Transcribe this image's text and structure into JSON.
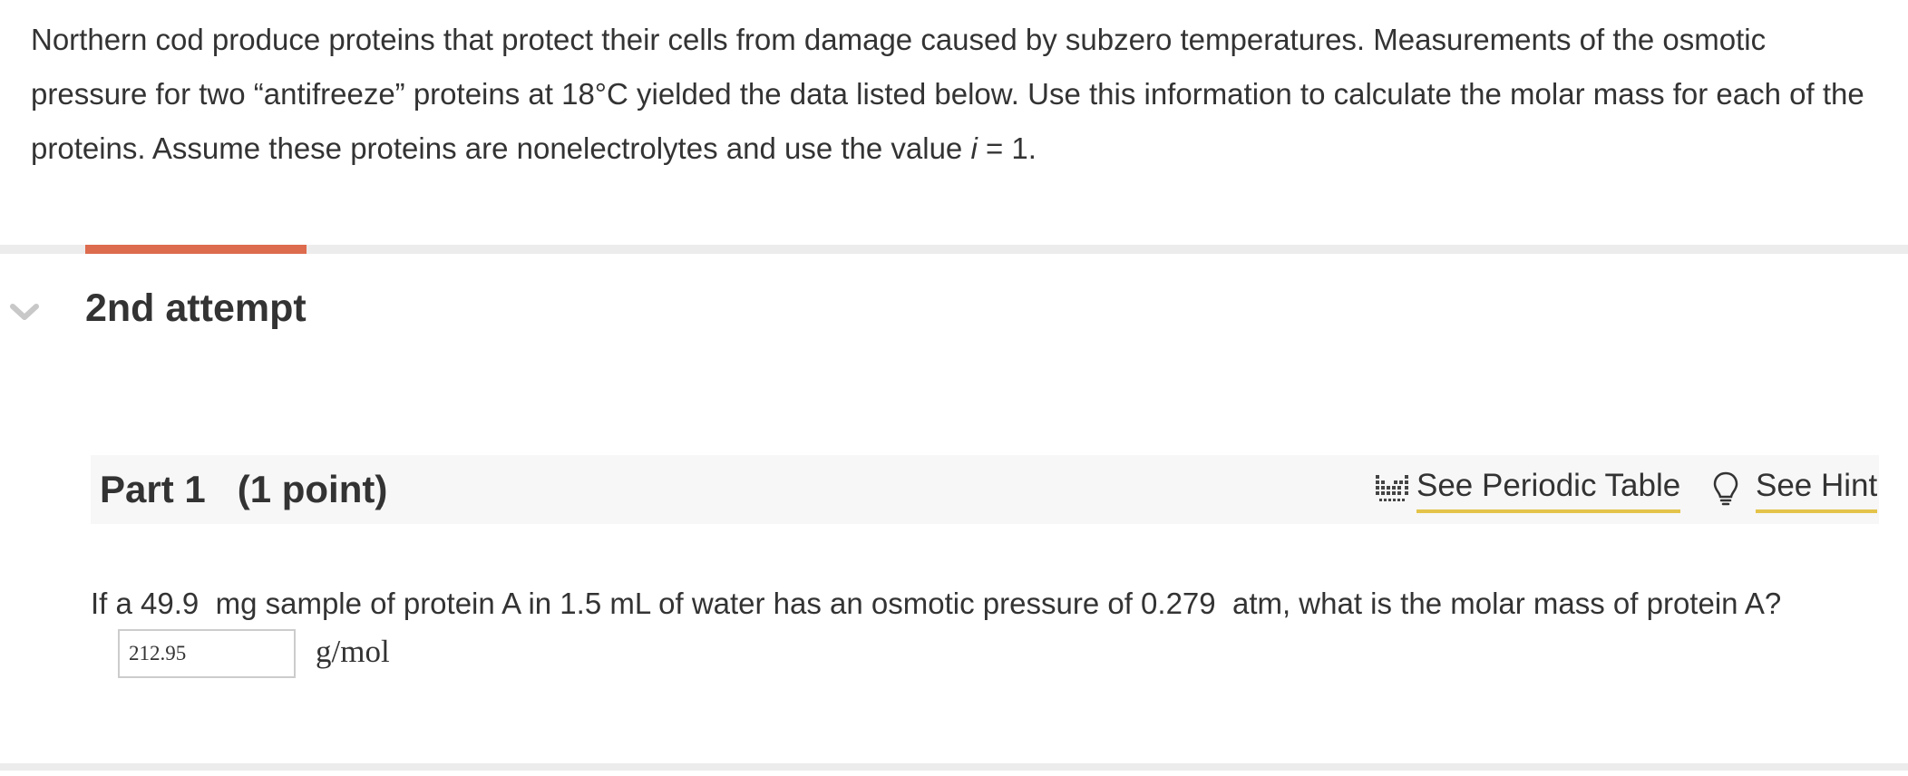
{
  "intro": {
    "line1": "Northern cod produce proteins that protect their cells from damage caused by subzero temperatures. Measurements of the osmotic",
    "line2": "pressure for two “antifreeze” proteins at 18°C yielded the data listed below. Use this information to calculate the molar mass for each of the",
    "line3_before": "proteins. Assume these proteins are nonelectrolytes and use the value ",
    "line3_var": "i",
    "line3_after": " = 1."
  },
  "attempt": {
    "title": "2nd attempt",
    "progress_color": "#dd6b4d",
    "chevron_icon": "chevron-down-icon"
  },
  "part": {
    "title": "Part 1   (1 point)",
    "periodic_label": "See Periodic Table",
    "hint_label": "See Hint",
    "periodic_icon": "periodic-table-icon",
    "hint_icon": "lightbulb-icon",
    "link_underline_color": "#e3c34a"
  },
  "question": {
    "text": "If a 49.9  mg sample of protein A in 1.5 mL of water has an osmotic pressure of 0.279  atm, what is the molar mass of protein A?",
    "answer_value": "212.95",
    "unit": "g/mol"
  }
}
